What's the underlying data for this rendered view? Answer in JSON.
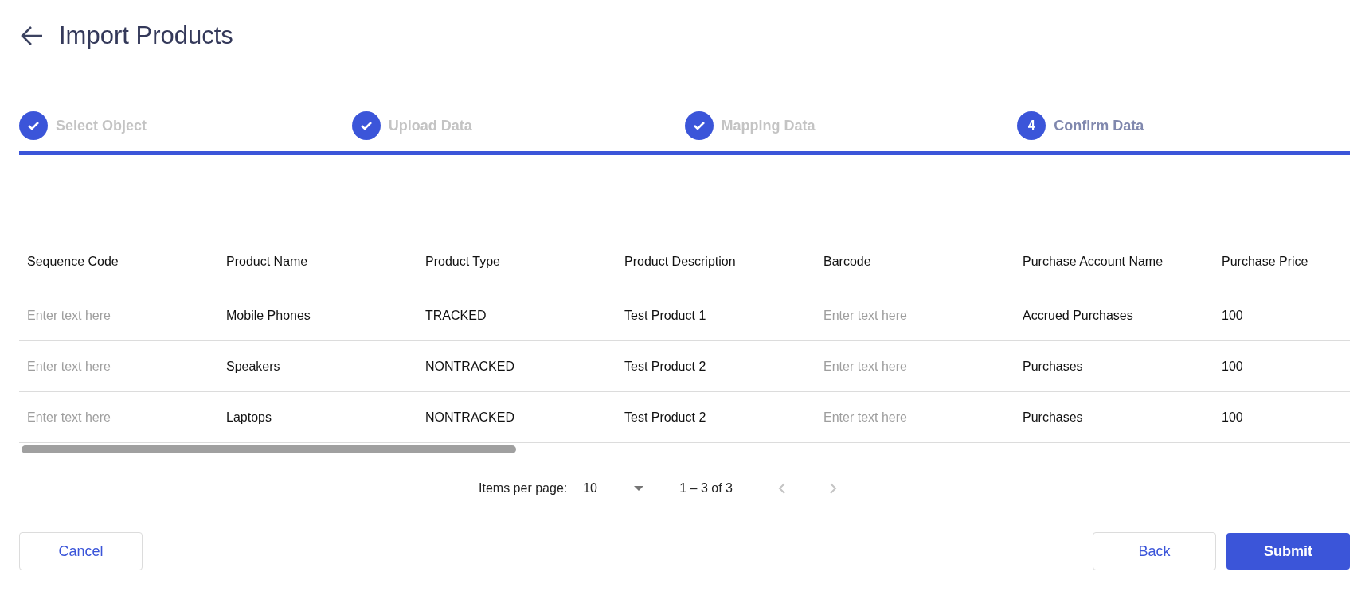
{
  "header": {
    "title": "Import Products"
  },
  "progress": {
    "level": 1
  },
  "steps": [
    {
      "label": "Select Object",
      "completed": true,
      "selected": false
    },
    {
      "label": "Upload Data",
      "completed": true,
      "selected": false
    },
    {
      "label": "Mapping Data",
      "completed": true,
      "selected": false
    },
    {
      "label": "Confirm Data",
      "number": "4",
      "completed": false,
      "selected": true
    }
  ],
  "table": {
    "columns": [
      "Sequence Code",
      "Product Name",
      "Product Type",
      "Product Description",
      "Barcode",
      "Purchase Account Name",
      "Purchase Price"
    ],
    "rows": [
      {
        "cells": [
          {
            "placeholder": "Enter text here"
          },
          {
            "text": "Mobile Phones"
          },
          {
            "text": "TRACKED"
          },
          {
            "text": "Test Product 1"
          },
          {
            "placeholder": "Enter text here"
          },
          {
            "text": "Accrued Purchases"
          },
          {
            "text": "100"
          }
        ]
      },
      {
        "cells": [
          {
            "placeholder": "Enter text here"
          },
          {
            "text": "Speakers"
          },
          {
            "text": "NONTRACKED"
          },
          {
            "text": "Test Product 2"
          },
          {
            "placeholder": "Enter text here"
          },
          {
            "text": "Purchases"
          },
          {
            "text": "100"
          }
        ]
      },
      {
        "cells": [
          {
            "placeholder": "Enter text here"
          },
          {
            "text": "Laptops"
          },
          {
            "text": "NONTRACKED"
          },
          {
            "text": "Test Product 2"
          },
          {
            "placeholder": "Enter text here"
          },
          {
            "text": "Purchases"
          },
          {
            "text": "100"
          }
        ]
      }
    ]
  },
  "pagination": {
    "items_per_page_label": "Items per page:",
    "items_per_page": "10",
    "range": "1 – 3 of 3",
    "previous": {
      "disabled": true
    },
    "next": {
      "disabled": true
    }
  },
  "buttons": {
    "cancel": "Cancel",
    "back": "Back",
    "submit": "Submit"
  }
}
